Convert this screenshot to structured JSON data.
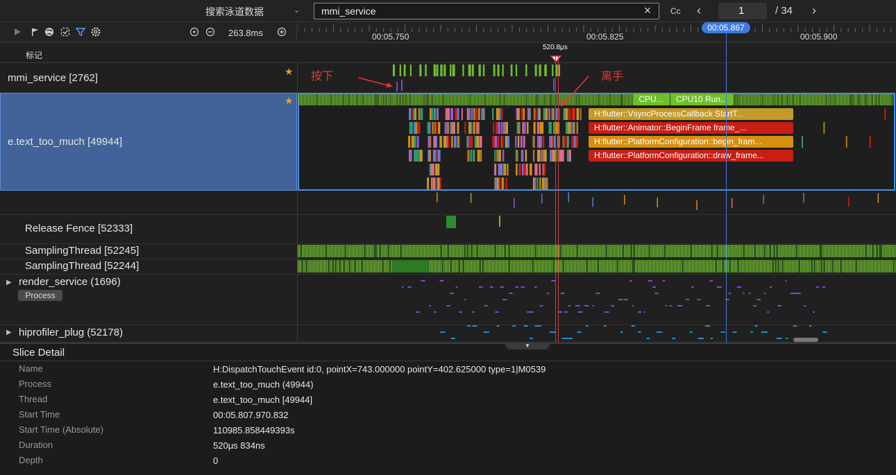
{
  "search": {
    "label": "搜索泳道数据",
    "value": "mmi_service",
    "case_label": "Cc",
    "page": "1",
    "total": "/ 34"
  },
  "toolbar": {
    "zoom": "263.8ms"
  },
  "ruler": {
    "ticks": [
      "00:05.750",
      "00:05.825",
      "00:05.900"
    ],
    "cursor": "00:05.867"
  },
  "marker": {
    "label": "标记",
    "range": "520.8μs"
  },
  "tracks": {
    "mmi": "mmi_service [2762]",
    "main": "e.text_too_much [49944]",
    "release": "Release Fence [52333]",
    "sampling1": "SamplingThread [52245]",
    "sampling2": "SamplingThread [52244]",
    "render": "render_service (1696)",
    "render_badge": "Process",
    "hiprof": "hiprofiler_plug (52178)"
  },
  "annotations": {
    "press": "按下",
    "release": "离手"
  },
  "slices": {
    "cpu1": "CPU...",
    "cpu2": "CPU10 Run...",
    "s1": "H:flutter::VsyncProcessCallback StartT...",
    "s2": "H:flutter::Animator::BeginFrame frame_...",
    "s3": "H:flutter::PlatformConfiguration::begin_fram...",
    "s4": "H:flutter::PlatformConfiguration::draw_frame..."
  },
  "detail": {
    "title": "Slice Detail",
    "rows": [
      {
        "k": "Name",
        "v": "H:DispatchTouchEvent id:0, pointX=743.000000 pointY=402.625000 type=1|M0539"
      },
      {
        "k": "Process",
        "v": "e.text_too_much (49944)"
      },
      {
        "k": "Thread",
        "v": "e.text_too_much [49944]"
      },
      {
        "k": "Start Time",
        "v": "00:05.807.970.832"
      },
      {
        "k": "Start Time (Absolute)",
        "v": "110985.858449393s"
      },
      {
        "k": "Duration",
        "v": "520μs 834ns"
      },
      {
        "k": "Depth",
        "v": "0"
      }
    ]
  },
  "colors": {
    "green": "#6fbe2c",
    "gold": "#c39a2a",
    "red": "#c81e14",
    "accent": "#3d7be0"
  }
}
